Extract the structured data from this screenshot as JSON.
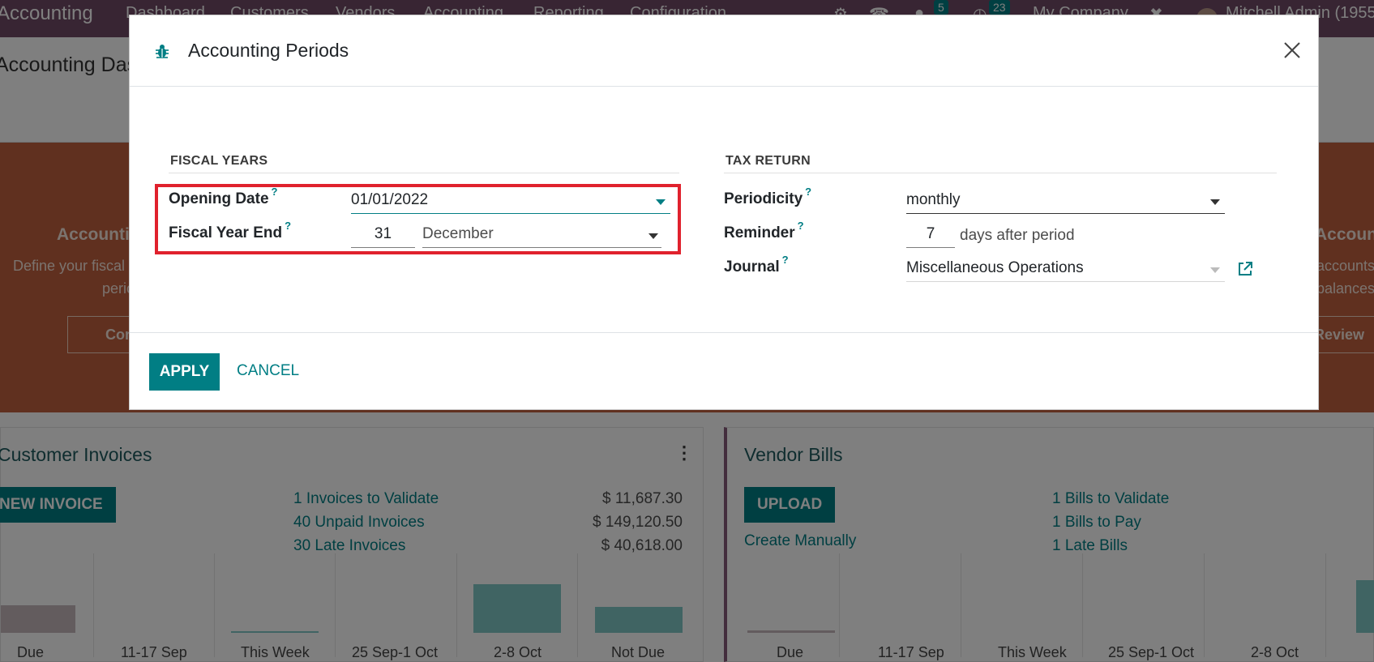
{
  "navbar": {
    "app_name": "Accounting",
    "menus": [
      "Dashboard",
      "Customers",
      "Vendors",
      "Accounting",
      "Reporting",
      "Configuration"
    ],
    "messages_badge": "5",
    "activities_badge": "23",
    "company": "My Company",
    "user": "Mitchell Admin (1955"
  },
  "breadcrumb": "Accounting Dashboard",
  "hero": {
    "left_title": "Accounting Periods",
    "left_line1": "Define your fiscal",
    "left_line2": "periods",
    "left_btn": "Configure",
    "right_title": "Accounts",
    "right_line1": "accounts",
    "right_line2": "balances.",
    "right_btn": "Review"
  },
  "customer_invoices": {
    "title": "Customer Invoices",
    "new_btn": "NEW INVOICE",
    "links": [
      "1 Invoices to Validate",
      "40 Unpaid Invoices",
      "30 Late Invoices"
    ],
    "amounts": [
      "$ 11,687.30",
      "$ 149,120.50",
      "$ 40,618.00"
    ],
    "x_labels": [
      "Due",
      "11-17 Sep",
      "This Week",
      "25 Sep-1 Oct",
      "2-8 Oct",
      "Not Due"
    ]
  },
  "vendor_bills": {
    "title": "Vendor Bills",
    "upload_btn": "UPLOAD",
    "create_manually": "Create Manually",
    "links": [
      "1 Bills to Validate",
      "1 Bills to Pay",
      "1 Late Bills"
    ],
    "x_labels": [
      "Due",
      "11-17 Sep",
      "This Week",
      "25 Sep-1 Oct",
      "2-8 Oct"
    ]
  },
  "modal": {
    "title": "Accounting Periods",
    "fiscal_years": {
      "section_title": "FISCAL YEARS",
      "opening_date_label": "Opening Date",
      "opening_date_value": "01/01/2022",
      "fiscal_year_end_label": "Fiscal Year End",
      "fiscal_year_end_day": "31",
      "fiscal_year_end_month": "December"
    },
    "tax_return": {
      "section_title": "TAX RETURN",
      "periodicity_label": "Periodicity",
      "periodicity_value": "monthly",
      "reminder_label": "Reminder",
      "reminder_value": "7",
      "reminder_suffix": "days after period",
      "journal_label": "Journal",
      "journal_value": "Miscellaneous Operations"
    },
    "help_marker": "?",
    "apply_label": "APPLY",
    "cancel_label": "CANCEL"
  },
  "colors": {
    "brand": "#714b67",
    "accent": "#017e84",
    "highlight": "#e0212d"
  }
}
